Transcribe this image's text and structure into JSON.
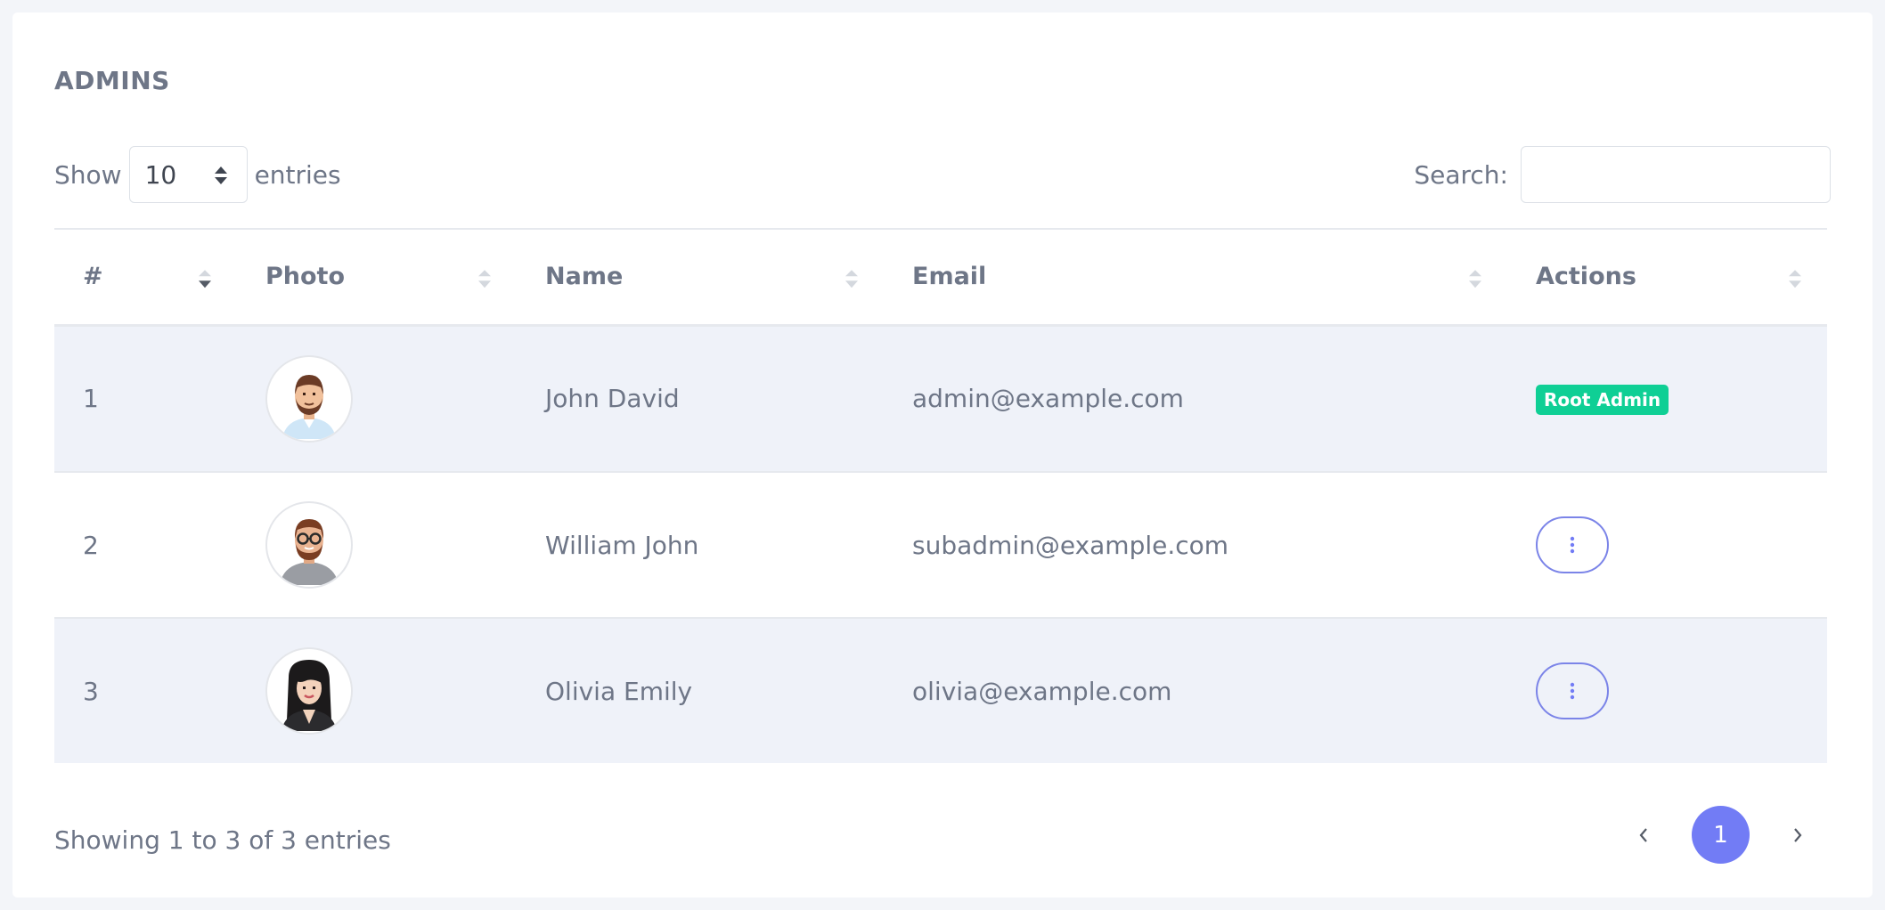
{
  "card": {
    "title": "ADMINS"
  },
  "length": {
    "prefix": "Show",
    "value": "10",
    "suffix": "entries"
  },
  "search": {
    "label": "Search:",
    "value": "",
    "placeholder": ""
  },
  "table": {
    "columns": [
      "#",
      "Photo",
      "Name",
      "Email",
      "Actions"
    ],
    "rows": [
      {
        "index": "1",
        "name": "John David",
        "email": "admin@example.com",
        "action": "Root Admin",
        "avatar": "man-beard-icon"
      },
      {
        "index": "2",
        "name": "William John",
        "email": "subadmin@example.com",
        "action": "more-vertical-icon",
        "avatar": "man-glasses-icon"
      },
      {
        "index": "3",
        "name": "Olivia Emily",
        "email": "olivia@example.com",
        "action": "more-vertical-icon",
        "avatar": "woman-icon"
      }
    ]
  },
  "footer": {
    "info": "Showing 1 to 3 of 3 entries"
  },
  "pagination": {
    "current": "1",
    "prev_icon": "chevron-left-icon",
    "next_icon": "chevron-right-icon"
  },
  "colors": {
    "accent": "#727cf5",
    "badge": "#0fcf95",
    "stripe": "#eff2f9"
  }
}
